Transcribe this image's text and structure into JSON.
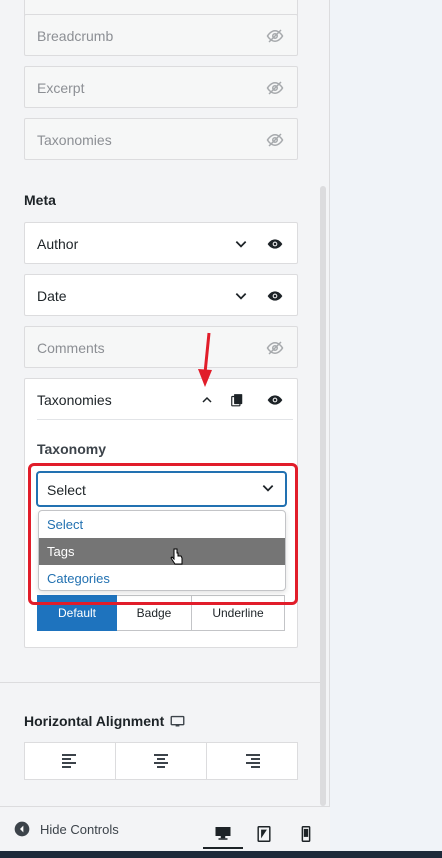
{
  "colors": {
    "accent": "#2271b1",
    "highlight": "#e11d2a",
    "active_segment": "#1e73be"
  },
  "top_controls": [
    {
      "label": "Breadcrumb",
      "icon": "eye-slash-icon"
    },
    {
      "label": "Excerpt",
      "icon": "eye-slash-icon"
    },
    {
      "label": "Taxonomies",
      "icon": "eye-slash-icon"
    }
  ],
  "meta": {
    "title": "Meta",
    "items": [
      {
        "label": "Author",
        "icons": [
          "chevron-down-icon",
          "eye-icon"
        ]
      },
      {
        "label": "Date",
        "icons": [
          "chevron-down-icon",
          "eye-icon"
        ]
      },
      {
        "label": "Comments",
        "icons": [
          "eye-slash-icon"
        ]
      }
    ],
    "expanded": {
      "label": "Taxonomies",
      "icons": [
        "chevron-up-icon",
        "copy-icon",
        "eye-icon"
      ],
      "field_label": "Taxonomy",
      "select_value": "Select",
      "options": [
        "Select",
        "Tags",
        "Categories"
      ],
      "hovered_option": "Tags",
      "style_segments": [
        "Default",
        "Badge",
        "Underline"
      ],
      "active_segment": "Default"
    }
  },
  "alignment": {
    "title": "Horizontal Alignment",
    "options": [
      "align-left-icon",
      "align-center-icon",
      "align-right-icon"
    ]
  },
  "footer": {
    "hide_label": "Hide Controls",
    "devices": [
      "desktop-icon",
      "tablet-icon",
      "mobile-icon"
    ],
    "active_device": "desktop-icon"
  }
}
